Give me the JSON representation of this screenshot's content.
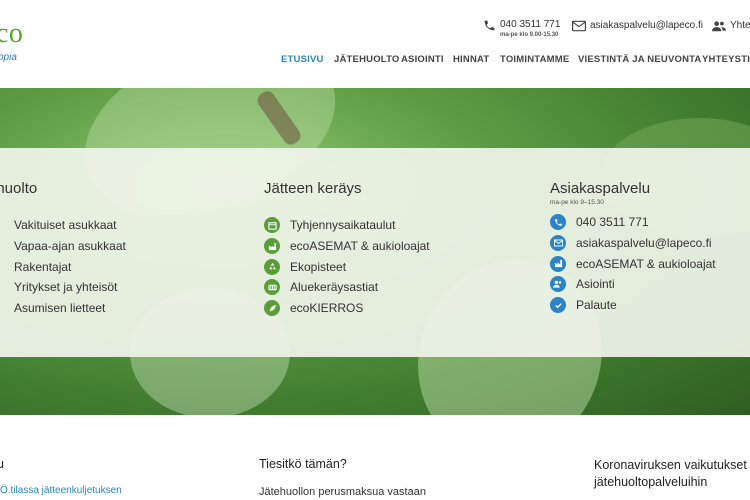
{
  "logo": {
    "text": "co",
    "tagline": "opia",
    "color": "#5aa62c"
  },
  "contact": {
    "phone": "040 3511 771",
    "phone_hours": "ma-pe klo 9.00-15.30",
    "email": "asiakaspalvelu@lapeco.fi",
    "contact_label": "Yhte"
  },
  "nav": {
    "items": [
      {
        "label": "ETUSIVU",
        "active": true
      },
      {
        "label": "JÄTEHUOLTO"
      },
      {
        "label": "ASIOINTI"
      },
      {
        "label": "HINNAT"
      },
      {
        "label": "TOIMINTAMME"
      },
      {
        "label": "VIESTINTÄ JA NEUVONTA"
      },
      {
        "label": "YHTEYSTIE"
      }
    ]
  },
  "panel": {
    "col1": {
      "title": "ehuolto",
      "items": [
        {
          "label": "Vakituiset asukkaat"
        },
        {
          "label": "Vapaa-ajan asukkaat"
        },
        {
          "label": "Rakentajat"
        },
        {
          "label": "Yritykset ja yhteisöt"
        },
        {
          "label": "Asumisen lietteet"
        }
      ]
    },
    "col2": {
      "title": "Jätteen keräys",
      "items": [
        {
          "label": "Tyhjennysaikataulut",
          "icon": "calendar-icon"
        },
        {
          "label": "ecoASEMAT & aukioloajat",
          "icon": "factory-icon"
        },
        {
          "label": "Ekopisteet",
          "icon": "recycle-icon"
        },
        {
          "label": "Aluekeräysastiat",
          "icon": "container-icon"
        },
        {
          "label": "ecoKIERROS",
          "icon": "leaf-icon"
        }
      ]
    },
    "col3": {
      "title": "Asiakaspalvelu",
      "subtitle": "ma-pe klo 9–15.30",
      "items": [
        {
          "label": "040 3511 771",
          "icon": "phone-icon"
        },
        {
          "label": "asiakaspalvelu@lapeco.fi",
          "icon": "mail-icon"
        },
        {
          "label": "ecoASEMAT & aukioloajat",
          "icon": "factory-icon"
        },
        {
          "label": "Asiointi",
          "icon": "users-icon"
        },
        {
          "label": "Palaute",
          "icon": "check-icon"
        }
      ]
    }
  },
  "lower": {
    "col1_title": "u",
    "col1_link": "Ö.tilassa jätteenkuljetuksen",
    "col2_title": "Tiesitkö tämän?",
    "col2_text": "Jätehuollon perusmaksua vastaan",
    "col3_title": "Koronaviruksen vaikutukset jätehuoltopalveluihin"
  },
  "colors": {
    "accent_blue": "#2b84c6",
    "accent_green": "#5a9e3a"
  }
}
